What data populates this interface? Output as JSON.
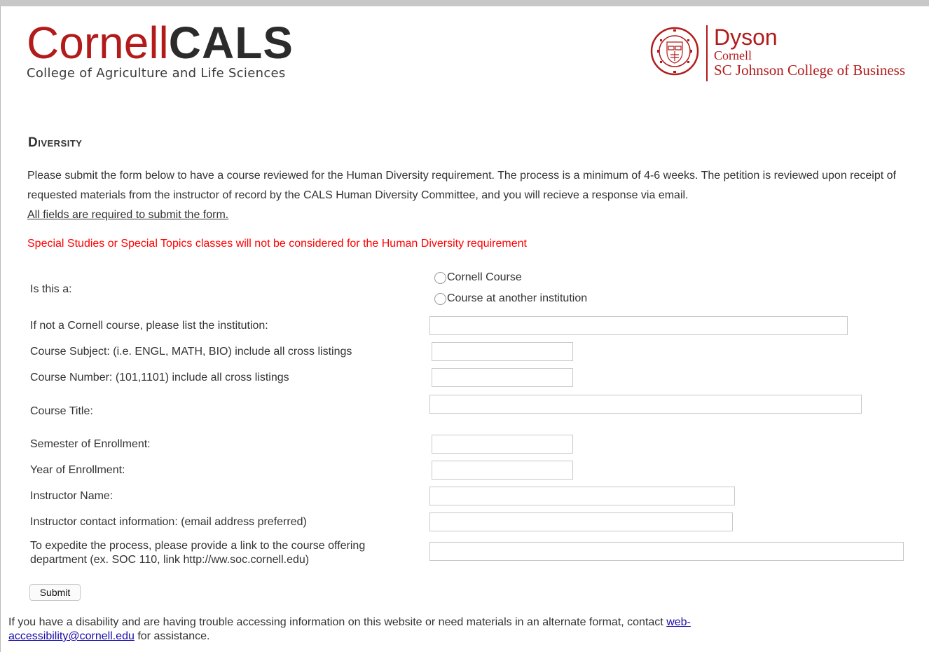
{
  "header": {
    "cals_logo": {
      "wordmark_cornell": "Cornell",
      "wordmark_cals": "CALS",
      "subtitle": "College of Agriculture and Life Sciences"
    },
    "dyson_logo": {
      "line1": "Dyson",
      "line2": "Cornell",
      "line3": "SC Johnson College of Business",
      "seal_text": "CORNELL UNIVERSITY FOUNDED A.D. 1865"
    },
    "brand_color": "#b31b1b"
  },
  "page": {
    "heading": "Diversity",
    "intro": "Please submit the form below to have a course reviewed for the Human Diversity requirement. The process is a minimum of 4-6 weeks. The petition is reviewed upon receipt of requested materials from the instructor of record by the CALS Human Diversity Committee, and you will recieve a response via email.",
    "required_note": "All fields are required to submit the form.",
    "warning": "Special Studies or Special Topics classes will not be considered for the Human Diversity requirement",
    "warning_color": "#ff0000"
  },
  "form": {
    "course_type": {
      "label": "Is this a:",
      "options": [
        "Cornell Course",
        "Course at another institution"
      ]
    },
    "institution_label": "If not a Cornell course, please list the institution:",
    "subject_label": "Course Subject: (i.e. ENGL, MATH, BIO) include all cross listings",
    "number_label": "Course Number: (101,1101) include all cross listings",
    "title_label": "Course Title:",
    "semester_label": "Semester of Enrollment:",
    "year_label": "Year of Enrollment:",
    "instructor_label": "Instructor Name:",
    "contact_label": "Instructor contact information: (email address preferred)",
    "link_label_line1": "To expedite the process, please provide a link to the course offering",
    "link_label_line2": "department (ex. SOC 110, link http://ww.soc.cornell.edu)",
    "submit_label": "Submit"
  },
  "footer": {
    "text_before": "If you have a disability and are having trouble accessing information on this website or need materials in an alternate format, contact ",
    "email_link_part1": "web-",
    "email_link_part2": "accessibility@cornell.edu",
    "text_after": " for assistance."
  }
}
